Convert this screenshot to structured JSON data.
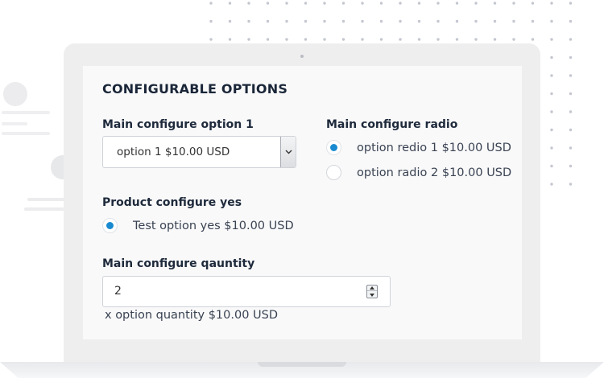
{
  "section_title": "CONFIGURABLE OPTIONS",
  "config_option_1": {
    "label": "Main configure option 1",
    "selected_value": "option 1 $10.00 USD",
    "icon": "chevron-down-icon"
  },
  "config_radio": {
    "label": "Main configure radio",
    "options": [
      {
        "label": "option redio 1 $10.00 USD",
        "checked": true
      },
      {
        "label": "option radio 2 $10.00 USD",
        "checked": false
      }
    ]
  },
  "config_yes": {
    "label": "Product configure yes",
    "option": {
      "label": "Test option yes $10.00 USD",
      "checked": true
    }
  },
  "config_quantity": {
    "label": "Main configure qauntity",
    "value": "2",
    "note": "x option quantity $10.00 USD",
    "icon": "spinner-icon"
  },
  "colors": {
    "accent": "#1a8ad0",
    "screen_bg": "#f9f9fa",
    "laptop_frame": "#eeeeef",
    "dot_color": "#c4c7d0"
  }
}
